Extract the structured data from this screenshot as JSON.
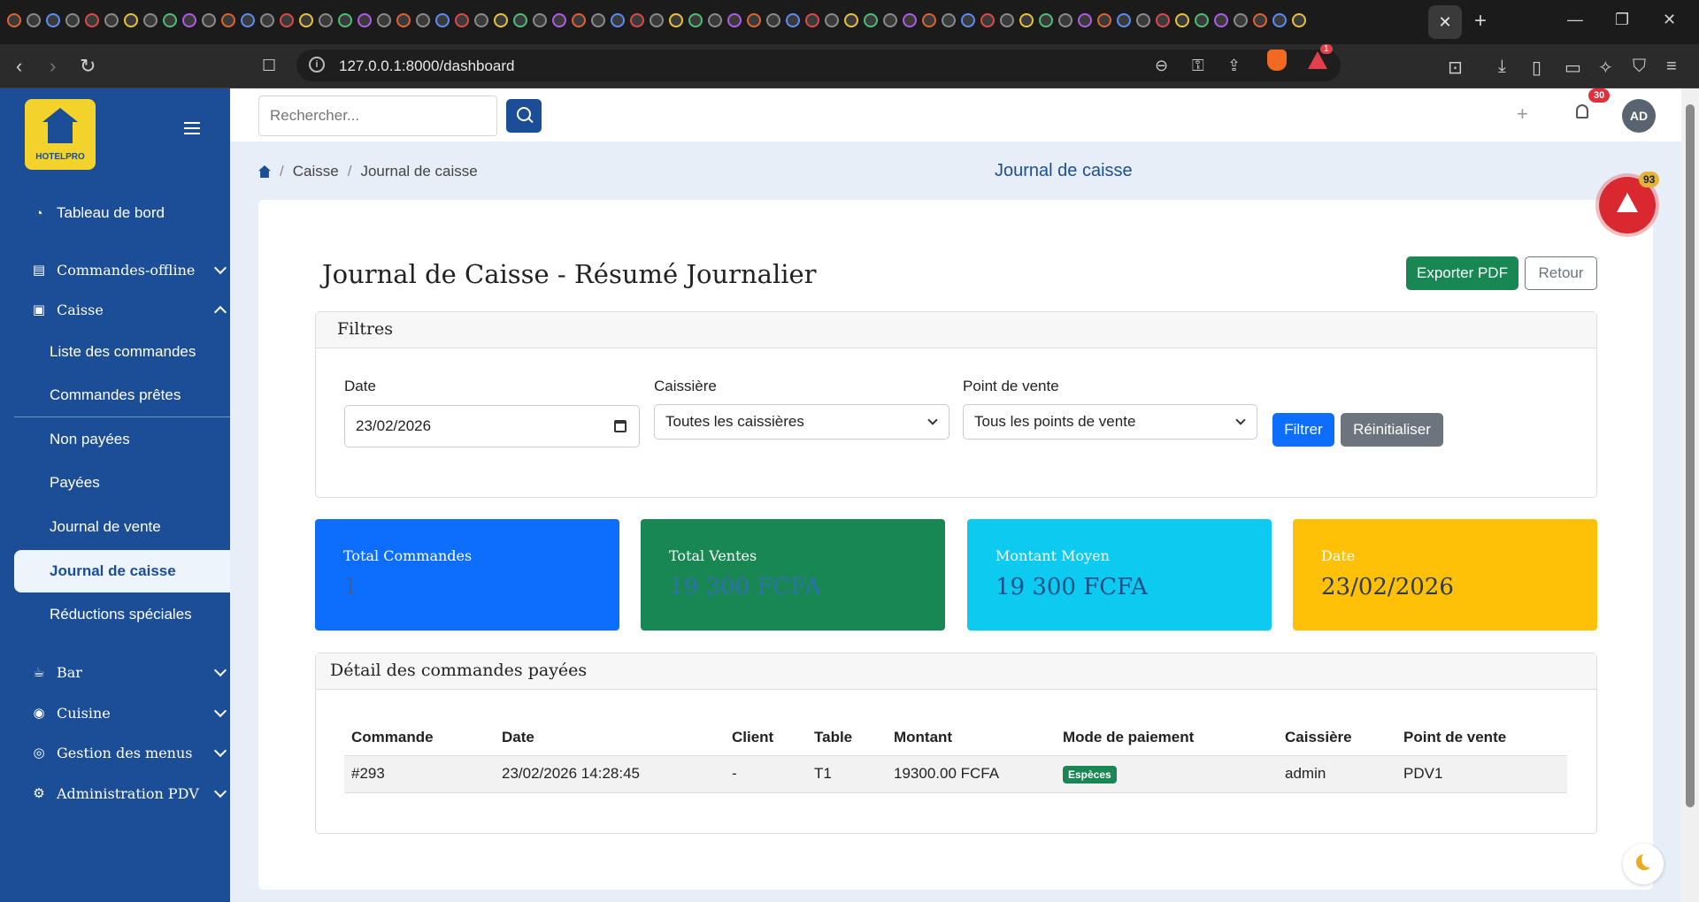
{
  "browser": {
    "url": "127.0.0.1:8000/dashboard",
    "alert_badge": "1"
  },
  "sidebar": {
    "logo_text": "HOTELPRO",
    "items": [
      {
        "label": "Tableau de bord",
        "icon": "gauge-icon"
      },
      {
        "label": "Commandes-offline",
        "icon": "list-icon"
      },
      {
        "label": "Caisse",
        "icon": "cash-register-icon"
      },
      {
        "label": "Bar",
        "icon": "coffee-icon"
      },
      {
        "label": "Cuisine",
        "icon": "cuisine-icon"
      },
      {
        "label": "Gestion des menus",
        "icon": "book-icon"
      },
      {
        "label": "Administration PDV",
        "icon": "gear-icon"
      }
    ],
    "caisse_sub": [
      "Liste des commandes",
      "Commandes prêtes",
      "Non payées",
      "Payées",
      "Journal de vente",
      "Journal de caisse",
      "Réductions spéciales"
    ],
    "active_sub": "Journal de caisse"
  },
  "topbar": {
    "search_placeholder": "Rechercher...",
    "notif_count": "30",
    "avatar": "AD"
  },
  "breadcrumb": {
    "level1": "Caisse",
    "level2": "Journal de caisse"
  },
  "page_heading": "Journal de caisse",
  "alert_fab_count": "93",
  "card": {
    "title": "Journal de Caisse - Résumé Journalier",
    "export_label": "Exporter PDF",
    "back_label": "Retour"
  },
  "filters": {
    "title": "Filtres",
    "date_label": "Date",
    "date_value": "23/02/2026",
    "cashier_label": "Caissière",
    "cashier_value": "Toutes les caissières",
    "pos_label": "Point de vente",
    "pos_value": "Tous les points de vente",
    "filter_button": "Filtrer",
    "reset_button": "Réinitialiser"
  },
  "stats": [
    {
      "label": "Total Commandes",
      "value": "1",
      "color": "#0d6efd"
    },
    {
      "label": "Total Ventes",
      "value": "19 300 FCFA",
      "color": "#198754"
    },
    {
      "label": "Montant Moyen",
      "value": "19 300 FCFA",
      "color": "#0dcaf0"
    },
    {
      "label": "Date",
      "value": "23/02/2026",
      "color": "#ffc107"
    }
  ],
  "orders": {
    "title": "Détail des commandes payées",
    "columns": [
      "Commande",
      "Date",
      "Client",
      "Table",
      "Montant",
      "Mode de paiement",
      "Caissière",
      "Point de vente"
    ],
    "rows": [
      {
        "commande": "#293",
        "date": "23/02/2026 14:28:45",
        "client": "-",
        "table": "T1",
        "montant": "19300.00 FCFA",
        "mode": "Espèces",
        "caissiere": "admin",
        "pdv": "PDV1"
      }
    ]
  }
}
